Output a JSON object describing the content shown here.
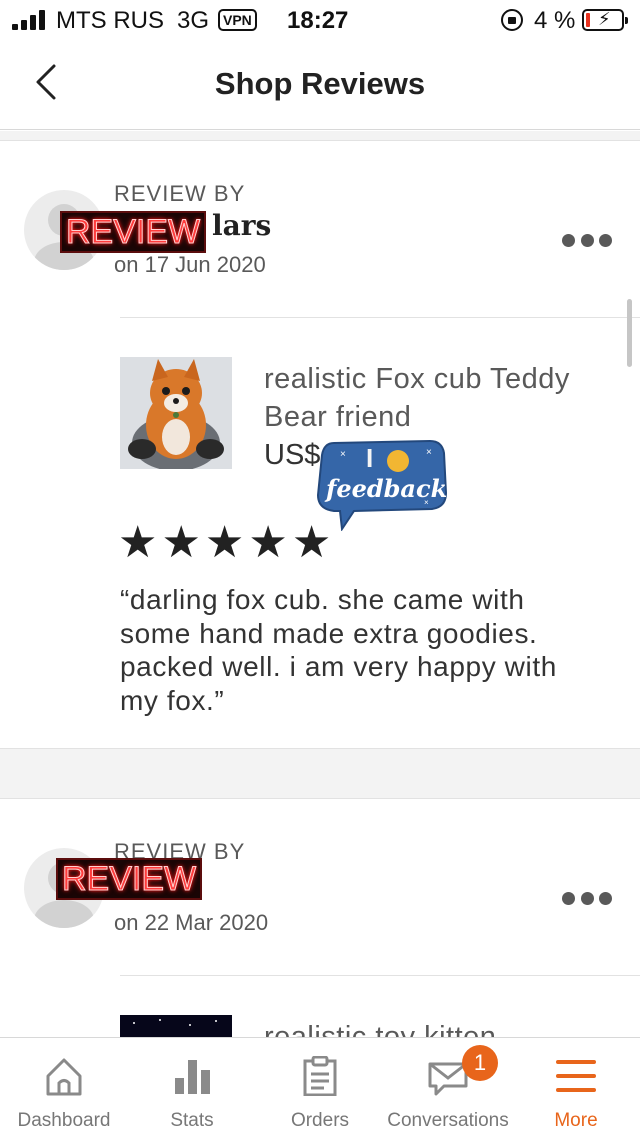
{
  "status_bar": {
    "carrier": "MTS RUS",
    "network": "3G",
    "vpn": "VPN",
    "time": "18:27",
    "battery_percent": "4 %",
    "battery_level": 0.04,
    "battery_color": "#e8321f"
  },
  "header": {
    "title": "Shop Reviews",
    "back_icon": "chevron-left-icon"
  },
  "reviews": [
    {
      "review_by": "REVIEW BY",
      "reviewer": "lars",
      "sticker": "REVIEW",
      "date": "on 17 Jun 2020",
      "product_title": "realistic Fox cub Teddy Bear friend",
      "price": "US$",
      "stars": 5,
      "text": "“darling fox cub.  she came with some hand made extra goodies. packed well.  i am very happy with my fox.”"
    },
    {
      "review_by": "REVIEW BY",
      "sticker": "REVIEW",
      "date": "on 22 Mar 2020",
      "product_title": "realistic toy kitten"
    }
  ],
  "stickers": {
    "feedback_top": "I",
    "feedback_bottom": "feedback"
  },
  "tab_bar": {
    "tabs": [
      {
        "label": "Dashboard",
        "icon": "home-icon"
      },
      {
        "label": "Stats",
        "icon": "bar-chart-icon"
      },
      {
        "label": "Orders",
        "icon": "clipboard-icon"
      },
      {
        "label": "Conversations",
        "icon": "envelope-icon"
      },
      {
        "label": "More",
        "icon": "menu-icon"
      }
    ],
    "active": "More",
    "badge_count": "1",
    "accent": "#e8651b"
  }
}
